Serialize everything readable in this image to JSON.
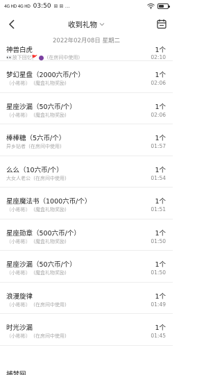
{
  "status_bar": {
    "network": "4G HD 4G HD",
    "time": "03:50",
    "extra_icons": "⊠ ⊠ …",
    "battery_percent": 60,
    "colors": {
      "text": "#222222"
    }
  },
  "nav": {
    "title": "收到礼物",
    "back_icon": "back-arrow-icon",
    "dropdown_icon": "chevron-down-icon",
    "calendar_icon": "calendar-icon"
  },
  "date_header": "2022年02月08日 星期二",
  "gifts": [
    {
      "name": "神兽白虎",
      "sender": "👀放下回忆🚩",
      "tail": "(在房间中使用)",
      "count": "1个",
      "time": "02:10",
      "has_emoji": true
    },
    {
      "name": "梦幻星盘（2000六币/个）",
      "sender": "（小彬彬）",
      "tail": "(魔盒礼物奖励)",
      "count": "1个",
      "time": "02:06"
    },
    {
      "name": "星座沙漏（50六币/个）",
      "sender": "（小彬彬）",
      "tail": "(魔盒礼物奖励)",
      "count": "1个",
      "time": "02:06"
    },
    {
      "name": "棒棒糖（5六币/个）",
      "sender": "异乡钻者",
      "tail": "(在房间中使用)",
      "count": "1个",
      "time": "01:57"
    },
    {
      "name": "么么（10六币/个）",
      "sender": "大女人老公",
      "tail": "(在房间中使用)",
      "count": "1个",
      "time": "01:54"
    },
    {
      "name": "星座魔法书（1000六币/个）",
      "sender": "（小彬彬）",
      "tail": "(魔盒礼物奖励)",
      "count": "1个",
      "time": "01:51"
    },
    {
      "name": "星座勋章（500六币/个）",
      "sender": "（小彬彬）",
      "tail": "(魔盒礼物奖励)",
      "count": "1个",
      "time": "01:50"
    },
    {
      "name": "星座沙漏（50六币/个）",
      "sender": "（小彬彬）",
      "tail": "(魔盒礼物奖励)",
      "count": "1个",
      "time": "01:50"
    },
    {
      "name": "浪漫旋律",
      "sender": "（小彬彬）",
      "tail": "(在房间中使用)",
      "count": "1个",
      "time": "01:49"
    },
    {
      "name": "时光沙漏",
      "sender": "（小彬彬）",
      "tail": "(在房间中使用)",
      "count": "1个",
      "time": "01:45"
    }
  ],
  "partial_item": "捕梦网"
}
